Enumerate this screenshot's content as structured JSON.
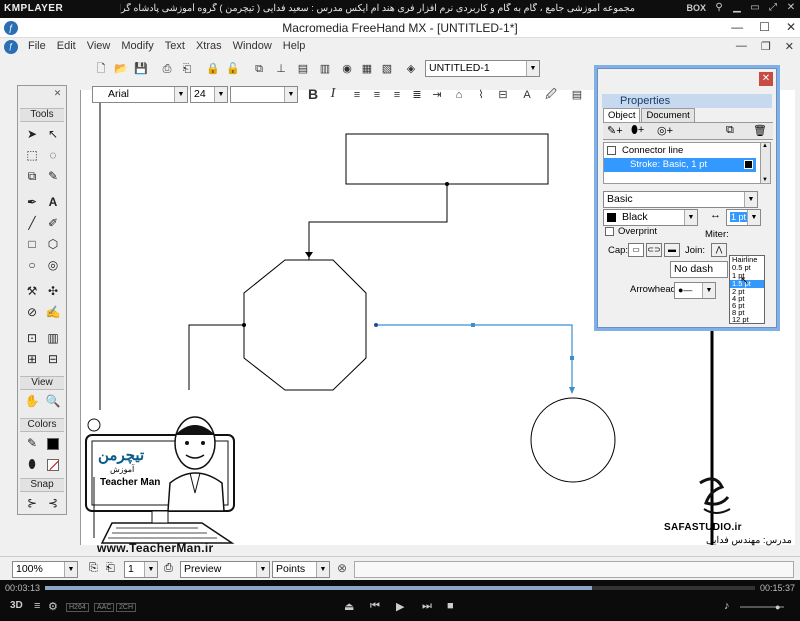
{
  "player": {
    "logo": "KMPLAYER",
    "title": "مجموعه آموزشی جامع ، گام به گام و کاربردی نرم افزار فری هند ام ایکس   مدرس : سعید فدایی ( تیچرمن ) گروه آموزشی پادشاه گرافیست ها",
    "box_label": "BOX",
    "time_elapsed": "00:03:13",
    "time_total": "00:15:37",
    "seek_progress": 0.77,
    "tags": [
      "H264",
      "AAC",
      "2CH"
    ]
  },
  "app": {
    "title": "Macromedia FreeHand MX - [UNTITLED-1*]",
    "menu": [
      "File",
      "Edit",
      "View",
      "Modify",
      "Text",
      "Xtras",
      "Window",
      "Help"
    ]
  },
  "toolbar": {
    "document_name": "UNTITLED-1",
    "font_name": "Arial",
    "font_size": "24",
    "bold": "B",
    "italic": "I"
  },
  "tools": {
    "title": "Tools",
    "view": "View",
    "colors": "Colors",
    "snap": "Snap"
  },
  "properties": {
    "title": "Properties",
    "tabs": [
      "Object",
      "Document"
    ],
    "list": [
      "Connector line",
      "Stroke: Basic, 1 pt"
    ],
    "stroke_type": "Basic",
    "color": "Black",
    "width_value": "1 pt",
    "overprint": "Overprint",
    "miter": "Miter:",
    "cap": "Cap:",
    "join": "Join:",
    "dash": "No dash",
    "arrowheads": "Arrowheads:",
    "width_options": [
      "Hairline",
      "0.5 pt",
      "1 pt",
      "1.5 pt",
      "2 pt",
      "4 pt",
      "6 pt",
      "8 pt",
      "12 pt"
    ],
    "selected_index": 3
  },
  "status": {
    "zoom": "100%",
    "page": "1",
    "mode": "Preview",
    "units": "Points"
  },
  "watermark": {
    "brand_fa": "تیچرمن",
    "subtitle_fa": "آموزش",
    "brand_en": "Teacher Man",
    "url": "www.TeacherMan.ir",
    "studio": "SAFASTUDIO.ir",
    "teacher": "مدرس: مهندس فدایی"
  },
  "colors": {
    "accent": "#3399ff",
    "connector": "#3b8fd0",
    "panel_border": "#7fb0e6",
    "close": "#c74b43"
  }
}
